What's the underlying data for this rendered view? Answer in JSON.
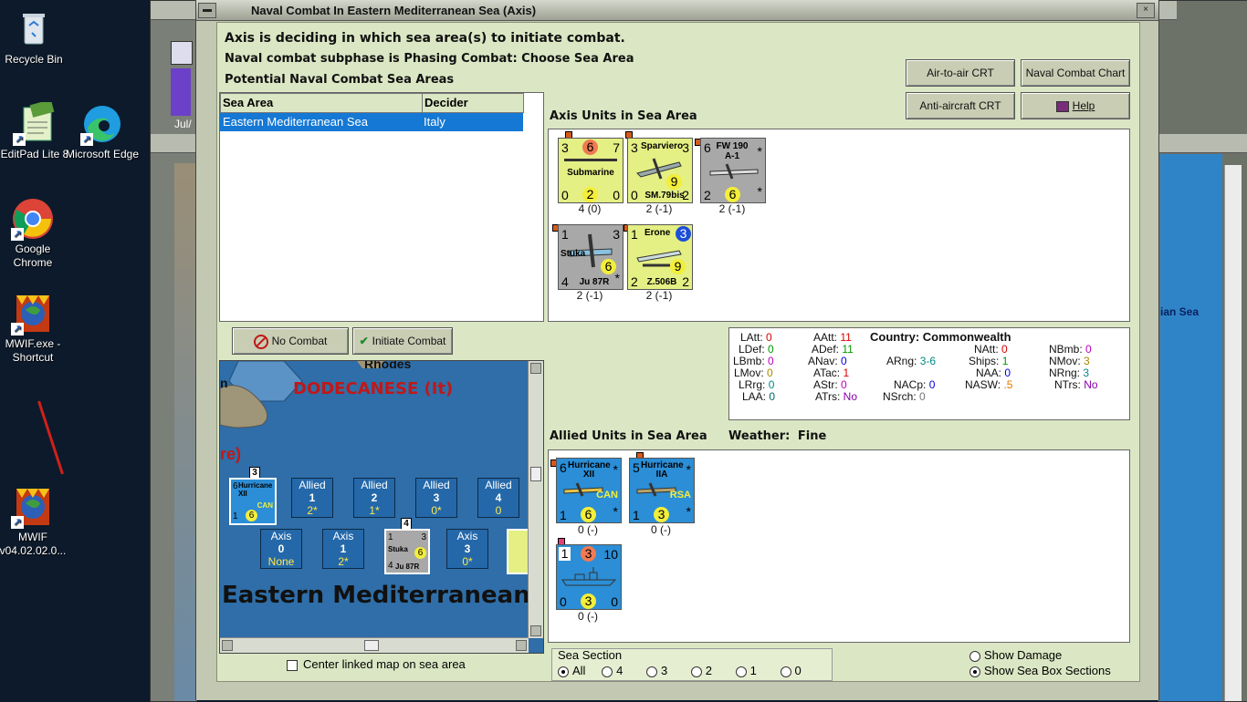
{
  "desktop": {
    "icons": [
      {
        "label": "Recycle Bin",
        "icon": "recycle-bin-icon"
      },
      {
        "label": "EditPad Lite 8",
        "icon": "editpad-icon"
      },
      {
        "label": "Microsoft Edge",
        "icon": "edge-icon"
      },
      {
        "label": "Google Chrome",
        "icon": "chrome-icon"
      },
      {
        "label": "MWIF.exe - Shortcut",
        "icon": "mwif-icon"
      },
      {
        "label": "MWIF v04.02.02.0...",
        "icon": "mwif-icon"
      }
    ]
  },
  "background": {
    "date_label": "Jul/",
    "right_sea_label": "ian Sea"
  },
  "dialog": {
    "title": "Naval Combat In Eastern Mediterranean Sea (Axis)",
    "heading": "Axis is deciding in which sea area(s) to initiate combat.",
    "subphase": "Naval combat subphase is Phasing Combat: Choose Sea Area",
    "potential_label": "Potential Naval Combat Sea Areas",
    "table": {
      "headers": [
        "Sea Area",
        "Decider"
      ],
      "rows": [
        [
          "Eastern Mediterranean Sea",
          "Italy"
        ]
      ]
    },
    "buttons": {
      "air_to_air": "Air-to-air CRT",
      "naval_chart": "Naval Combat Chart",
      "anti_aircraft": "Anti-aircraft CRT",
      "help": "Help",
      "no_combat": "No Combat",
      "initiate_combat": "Initiate Combat"
    },
    "axis_units_label": "Axis Units in Sea Area",
    "axis_units": [
      {
        "tl": "3",
        "tc": "6",
        "tr": "7",
        "name": "Submarine",
        "name2": "",
        "bl": "0",
        "bc": "2",
        "br": "0",
        "star": "",
        "sub": "4 (0)",
        "bg": "#e4ef84"
      },
      {
        "tl": "3",
        "tc": "",
        "tr": "3",
        "name": "Sparviero",
        "name2": "SM.79bis",
        "bl": "0",
        "bc": "9",
        "br": "2",
        "star": "",
        "sub": "2 (-1)",
        "bg": "#e4ef84"
      },
      {
        "tl": "6",
        "tc": "",
        "tr": "",
        "name": "FW 190 A-1",
        "name2": "",
        "bl": "2",
        "bc": "6",
        "br": "",
        "star": "*",
        "sub": "2 (-1)",
        "bg": "#a8a8a8"
      },
      {
        "tl": "1",
        "tc": "",
        "tr": "3",
        "name": "Stuka",
        "name2": "Ju 87R",
        "bl": "4",
        "bc": "6",
        "br": "",
        "star": "*",
        "sub": "2 (-1)",
        "bg": "#a8a8a8"
      },
      {
        "tl": "1",
        "tc": "",
        "tr": "3",
        "name": "Erone",
        "name2": "Z.506B",
        "bl": "2",
        "bc": "9",
        "br": "2",
        "star": "",
        "sub": "2 (-1)",
        "bg": "#e4ef84"
      }
    ],
    "stats": {
      "latt": {
        "label": "LAtt:",
        "value": "0"
      },
      "ldef": {
        "label": "LDef:",
        "value": "0"
      },
      "lbmb": {
        "label": "LBmb:",
        "value": "0"
      },
      "lmov": {
        "label": "LMov:",
        "value": "0"
      },
      "lrrg": {
        "label": "LRrg:",
        "value": "0"
      },
      "laa": {
        "label": "LAA:",
        "value": "0"
      },
      "aatt": {
        "label": "AAtt:",
        "value": "11"
      },
      "adef": {
        "label": "ADef:",
        "value": "11"
      },
      "anav": {
        "label": "ANav:",
        "value": "0"
      },
      "atac": {
        "label": "ATac:",
        "value": "1"
      },
      "astr": {
        "label": "AStr:",
        "value": "0"
      },
      "atrs": {
        "label": "ATrs:",
        "value": "No"
      },
      "country": {
        "label": "Country:",
        "value": "Commonwealth"
      },
      "arng": {
        "label": "ARng:",
        "value": "3-6"
      },
      "natt": {
        "label": "NAtt:",
        "value": "0"
      },
      "ships": {
        "label": "Ships:",
        "value": "1"
      },
      "naa": {
        "label": "NAA:",
        "value": "0"
      },
      "nacp": {
        "label": "NACp:",
        "value": "0"
      },
      "nasw": {
        "label": "NASW:",
        "value": ".5"
      },
      "nsrch": {
        "label": "NSrch:",
        "value": "0"
      },
      "nbmb": {
        "label": "NBmb:",
        "value": "0"
      },
      "nmov": {
        "label": "NMov:",
        "value": "3"
      },
      "nrng": {
        "label": "NRng:",
        "value": "3"
      },
      "ntrs": {
        "label": "NTrs:",
        "value": "No"
      }
    },
    "allied_units_label": "Allied Units in Sea Area",
    "weather_label": "Weather:",
    "weather_value": "Fine",
    "allied_units": [
      {
        "tl": "6",
        "name": "Hurricane XII",
        "nat": "CAN",
        "bl": "1",
        "bc": "6",
        "star": "*",
        "sub": "0 (-)"
      },
      {
        "tl": "5",
        "name": "Hurricane IIA",
        "nat": "RSA",
        "bl": "1",
        "bc": "3",
        "star": "*",
        "sub": "0 (-)"
      },
      {
        "tl": "1",
        "tc": "3",
        "tr": "10",
        "name": "",
        "bl": "0",
        "bc": "3",
        "br": "0",
        "sub": "0 (-)"
      }
    ],
    "map": {
      "place_rhodes": "Rhodes",
      "title": "DODECANESE (It)",
      "partial_label": "re)",
      "partial_n": "n",
      "sea_label": "Eastern Mediterranean",
      "stack_count_top": "3",
      "stack_count_mid": "4",
      "mini_counter_top": {
        "tl": "6",
        "name": "Hurricane XII",
        "nat": "CAN",
        "bl": "1",
        "bc": "6"
      },
      "mini_counter_mid": {
        "tl": "1",
        "tr": "3",
        "name": "Stuka",
        "name2": "Ju 87R",
        "bl": "4",
        "bc": "6"
      },
      "allied_zones": [
        {
          "title": "Allied",
          "num": "1",
          "val": "2*"
        },
        {
          "title": "Allied",
          "num": "2",
          "val": "1*"
        },
        {
          "title": "Allied",
          "num": "3",
          "val": "0*"
        },
        {
          "title": "Allied",
          "num": "4",
          "val": "0"
        }
      ],
      "axis_zones": [
        {
          "title": "Axis",
          "num": "0",
          "val": "None"
        },
        {
          "title": "Axis",
          "num": "1",
          "val": "2*"
        },
        {
          "title": "Axis",
          "num": "3",
          "val": "0*"
        }
      ],
      "center_checkbox": "Center linked map on sea area"
    },
    "sea_section": {
      "label": "Sea Section",
      "options": [
        "All",
        "4",
        "3",
        "2",
        "1",
        "0"
      ],
      "selected": "All"
    },
    "show_damage": "Show Damage",
    "show_sections": "Show Sea Box Sections"
  }
}
